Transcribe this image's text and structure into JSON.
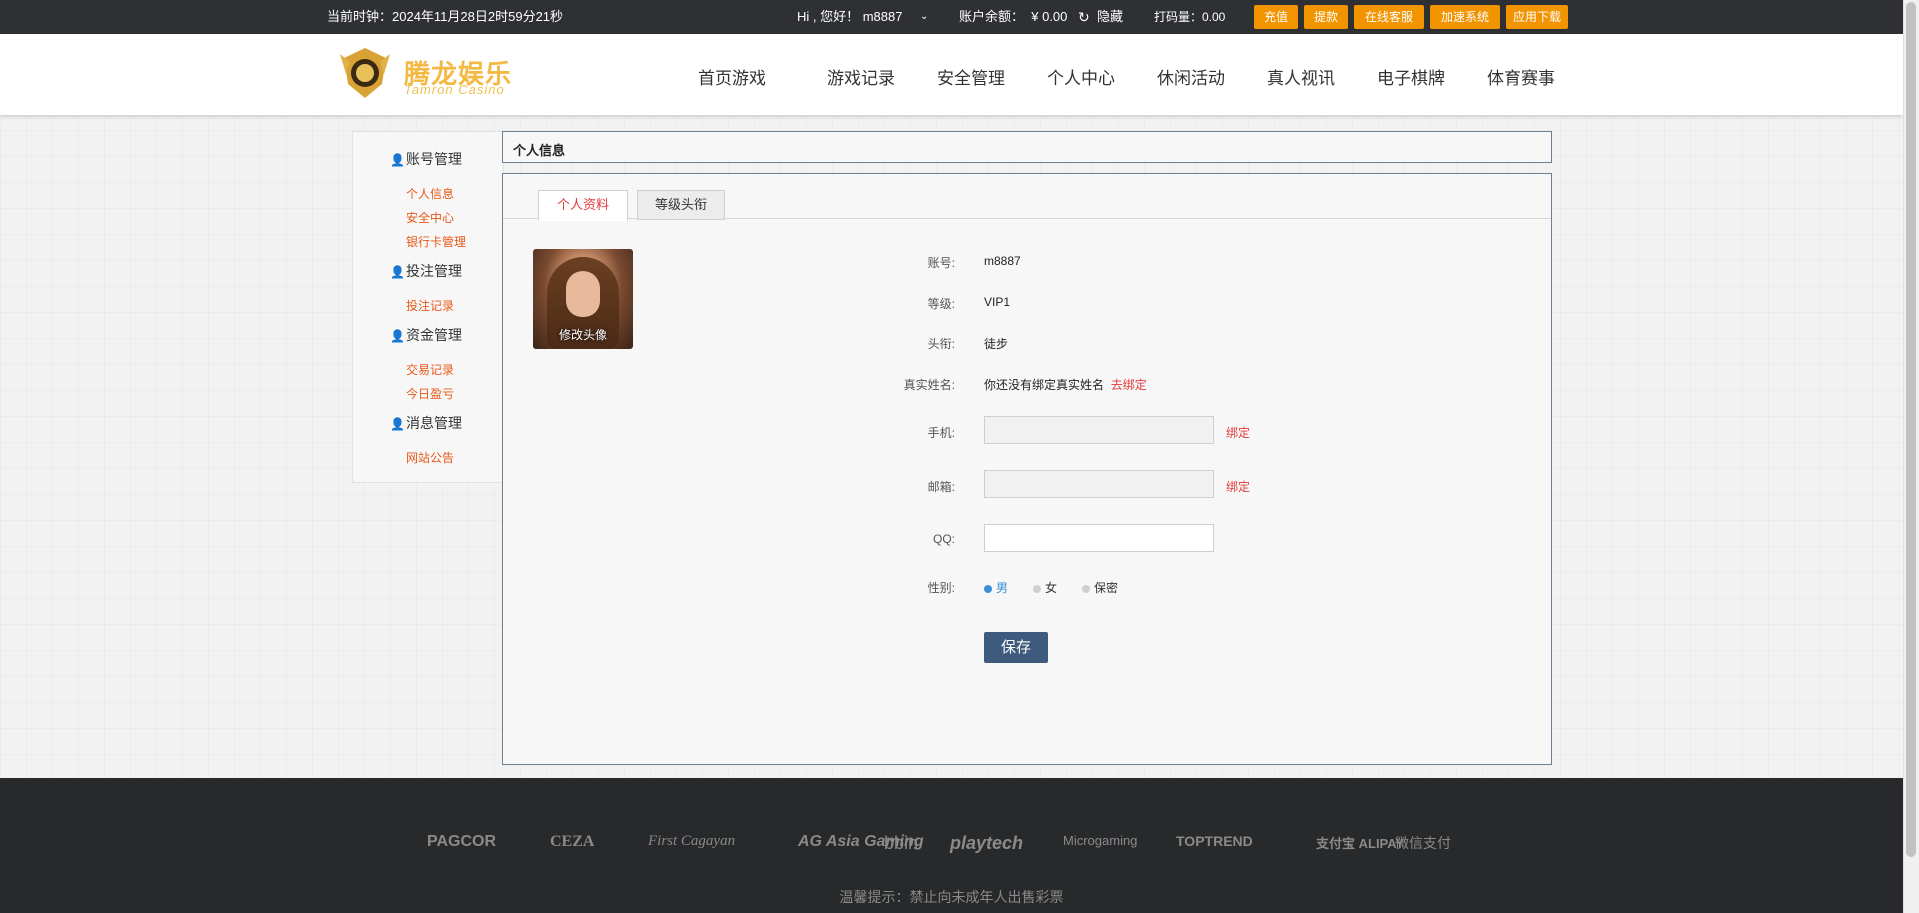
{
  "topbar": {
    "clock": "当前时钟：2024年11月28日2时59分21秒",
    "greeting": "Hi , 您好！ m8887",
    "balance_label": "账户余额：",
    "balance_value": "¥ 0.00",
    "hide_label": "隐藏",
    "bet_amount": "打码量：0.00",
    "buttons": [
      "充值",
      "提款",
      "在线客服",
      "加速系统",
      "应用下载"
    ]
  },
  "logo": {
    "cn": "腾龙娱乐",
    "en": "Tamron Casino"
  },
  "nav": [
    "首页游戏",
    "游戏记录",
    "安全管理",
    "个人中心",
    "休闲活动",
    "真人视讯",
    "电子棋牌",
    "体育赛事"
  ],
  "sidebar": {
    "sections": [
      {
        "title": "账号管理",
        "links": [
          "个人信息",
          "安全中心",
          "银行卡管理"
        ]
      },
      {
        "title": "投注管理",
        "links": [
          "投注记录"
        ]
      },
      {
        "title": "资金管理",
        "links": [
          "交易记录",
          "今日盈亏"
        ]
      },
      {
        "title": "消息管理",
        "links": [
          "网站公告"
        ]
      }
    ]
  },
  "panel": {
    "title": "个人信息",
    "tabs": [
      "个人资料",
      "等级头衔"
    ],
    "avatar_caption": "修改头像",
    "fields": {
      "account": {
        "label": "账号:",
        "value": "m8887"
      },
      "level": {
        "label": "等级:",
        "value": "VIP1"
      },
      "title": {
        "label": "头衔:",
        "value": "徒步"
      },
      "realname": {
        "label": "真实姓名:",
        "value": "你还没有绑定真实姓名",
        "action": "去绑定"
      },
      "phone": {
        "label": "手机:",
        "value": "",
        "action": "绑定"
      },
      "email": {
        "label": "邮箱:",
        "value": "",
        "action": "绑定"
      },
      "qq": {
        "label": "QQ:",
        "value": ""
      },
      "gender": {
        "label": "性别:",
        "options": [
          "男",
          "女",
          "保密"
        ],
        "selected": "男"
      }
    },
    "save_label": "保存"
  },
  "footer": {
    "logos": [
      "PAGCOR",
      "CEZA",
      "First Cagayan",
      "AG Asia Gaming",
      "bbin",
      "playtech",
      "Microgaming",
      "TOPTREND",
      "支付宝 ALIPAY",
      "微信支付"
    ],
    "notice": "温馨提示：禁止向未成年人出售彩票"
  },
  "colors": {
    "accent": "#f29400",
    "link": "#e8591a",
    "save": "#3e5b7e",
    "topbar": "#2e3033",
    "footer": "#27292b"
  }
}
